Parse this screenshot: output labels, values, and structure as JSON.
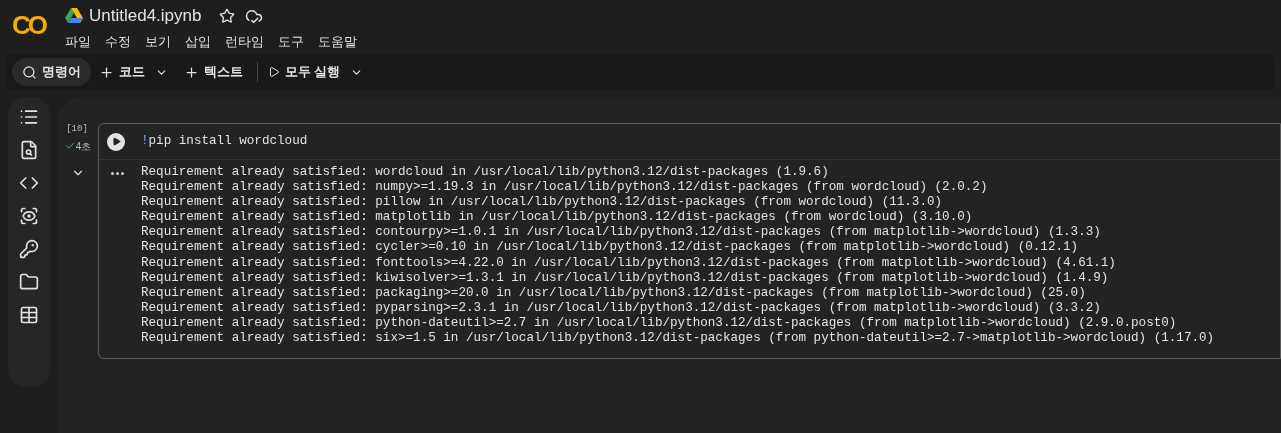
{
  "app": {
    "logo": "CO"
  },
  "notebook": {
    "title": "Untitled4.ipynb",
    "starred": false
  },
  "menu": [
    "파일",
    "수정",
    "보기",
    "삽입",
    "런타임",
    "도구",
    "도움말"
  ],
  "toolbar": {
    "command": "명령어",
    "add_code": "코드",
    "add_text": "텍스트",
    "run_all": "모두 실행"
  },
  "cell": {
    "execution_count": "[10]",
    "status": "4초",
    "succeeded": true,
    "code": [
      {
        "kind": "magic",
        "text": "!"
      },
      {
        "kind": "plain",
        "text": "pip install wordcloud"
      }
    ],
    "output_lines": [
      "Requirement already satisfied: wordcloud in /usr/local/lib/python3.12/dist-packages (1.9.6)",
      "Requirement already satisfied: numpy>=1.19.3 in /usr/local/lib/python3.12/dist-packages (from wordcloud) (2.0.2)",
      "Requirement already satisfied: pillow in /usr/local/lib/python3.12/dist-packages (from wordcloud) (11.3.0)",
      "Requirement already satisfied: matplotlib in /usr/local/lib/python3.12/dist-packages (from wordcloud) (3.10.0)",
      "Requirement already satisfied: contourpy>=1.0.1 in /usr/local/lib/python3.12/dist-packages (from matplotlib->wordcloud) (1.3.3)",
      "Requirement already satisfied: cycler>=0.10 in /usr/local/lib/python3.12/dist-packages (from matplotlib->wordcloud) (0.12.1)",
      "Requirement already satisfied: fonttools>=4.22.0 in /usr/local/lib/python3.12/dist-packages (from matplotlib->wordcloud) (4.61.1)",
      "Requirement already satisfied: kiwisolver>=1.3.1 in /usr/local/lib/python3.12/dist-packages (from matplotlib->wordcloud) (1.4.9)",
      "Requirement already satisfied: packaging>=20.0 in /usr/local/lib/python3.12/dist-packages (from matplotlib->wordcloud) (25.0)",
      "Requirement already satisfied: pyparsing>=2.3.1 in /usr/local/lib/python3.12/dist-packages (from matplotlib->wordcloud) (3.3.2)",
      "Requirement already satisfied: python-dateutil>=2.7 in /usr/local/lib/python3.12/dist-packages (from matplotlib->wordcloud) (2.9.0.post0)",
      "Requirement already satisfied: six>=1.5 in /usr/local/lib/python3.12/dist-packages (from python-dateutil>=2.7->matplotlib->wordcloud) (1.17.0)"
    ]
  }
}
